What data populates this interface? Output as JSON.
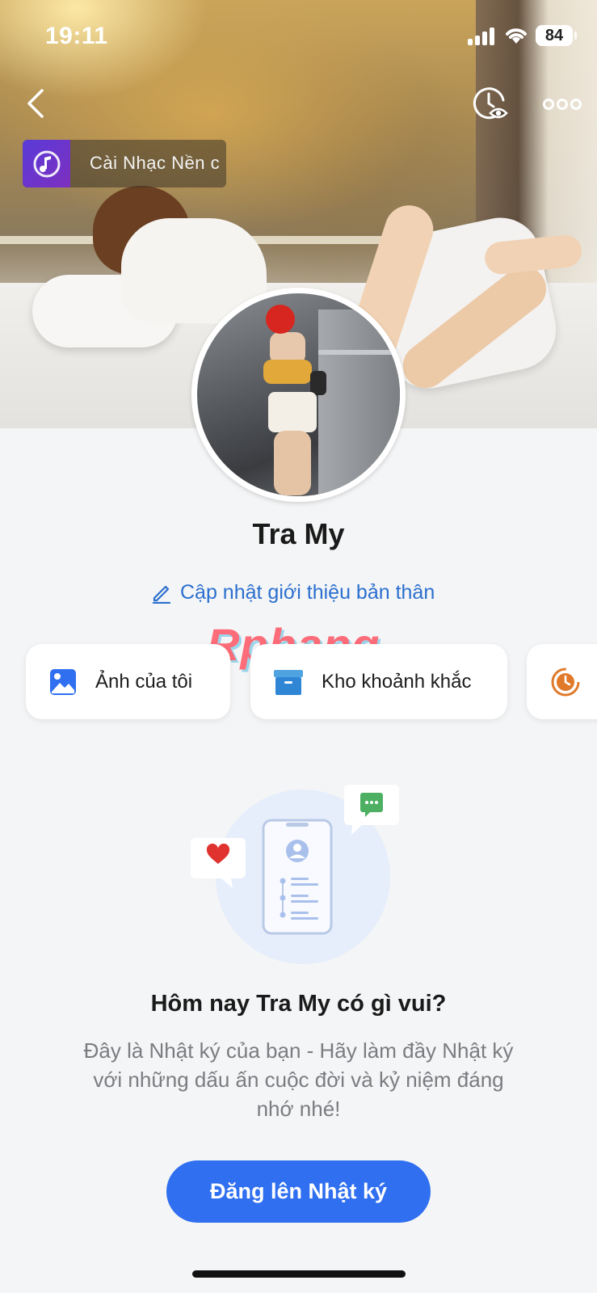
{
  "status_bar": {
    "time": "19:11",
    "battery": "84"
  },
  "header": {
    "back_icon": "chevron-left-icon",
    "viewer_icon": "clock-eye-icon",
    "more_icon": "more-horizontal-icon"
  },
  "music_chip": {
    "label": "Cài Nhạc Nền c",
    "icon": "music-note-icon"
  },
  "profile": {
    "name": "Tra My",
    "update_bio_label": "Cập nhật giới thiệu bản thân"
  },
  "watermark": "Rphang",
  "shortcuts": [
    {
      "label": "Ảnh của tôi",
      "icon": "image-icon"
    },
    {
      "label": "Kho khoảnh khắc",
      "icon": "archive-box-icon"
    },
    {
      "label": "",
      "icon": "history-clock-icon"
    }
  ],
  "empty_state": {
    "title": "Hôm nay Tra My có gì vui?",
    "description": "Đây là Nhật ký của bạn - Hãy làm đầy Nhật ký với những dấu ấn cuộc đời và kỷ niệm đáng nhớ nhé!",
    "button_label": "Đăng lên Nhật ký"
  },
  "colors": {
    "accent": "#2f6ff0",
    "link": "#2b6fcf",
    "background": "#f4f5f6",
    "heart": "#e0322f",
    "chat": "#4caf62",
    "history": "#e07a2a"
  }
}
